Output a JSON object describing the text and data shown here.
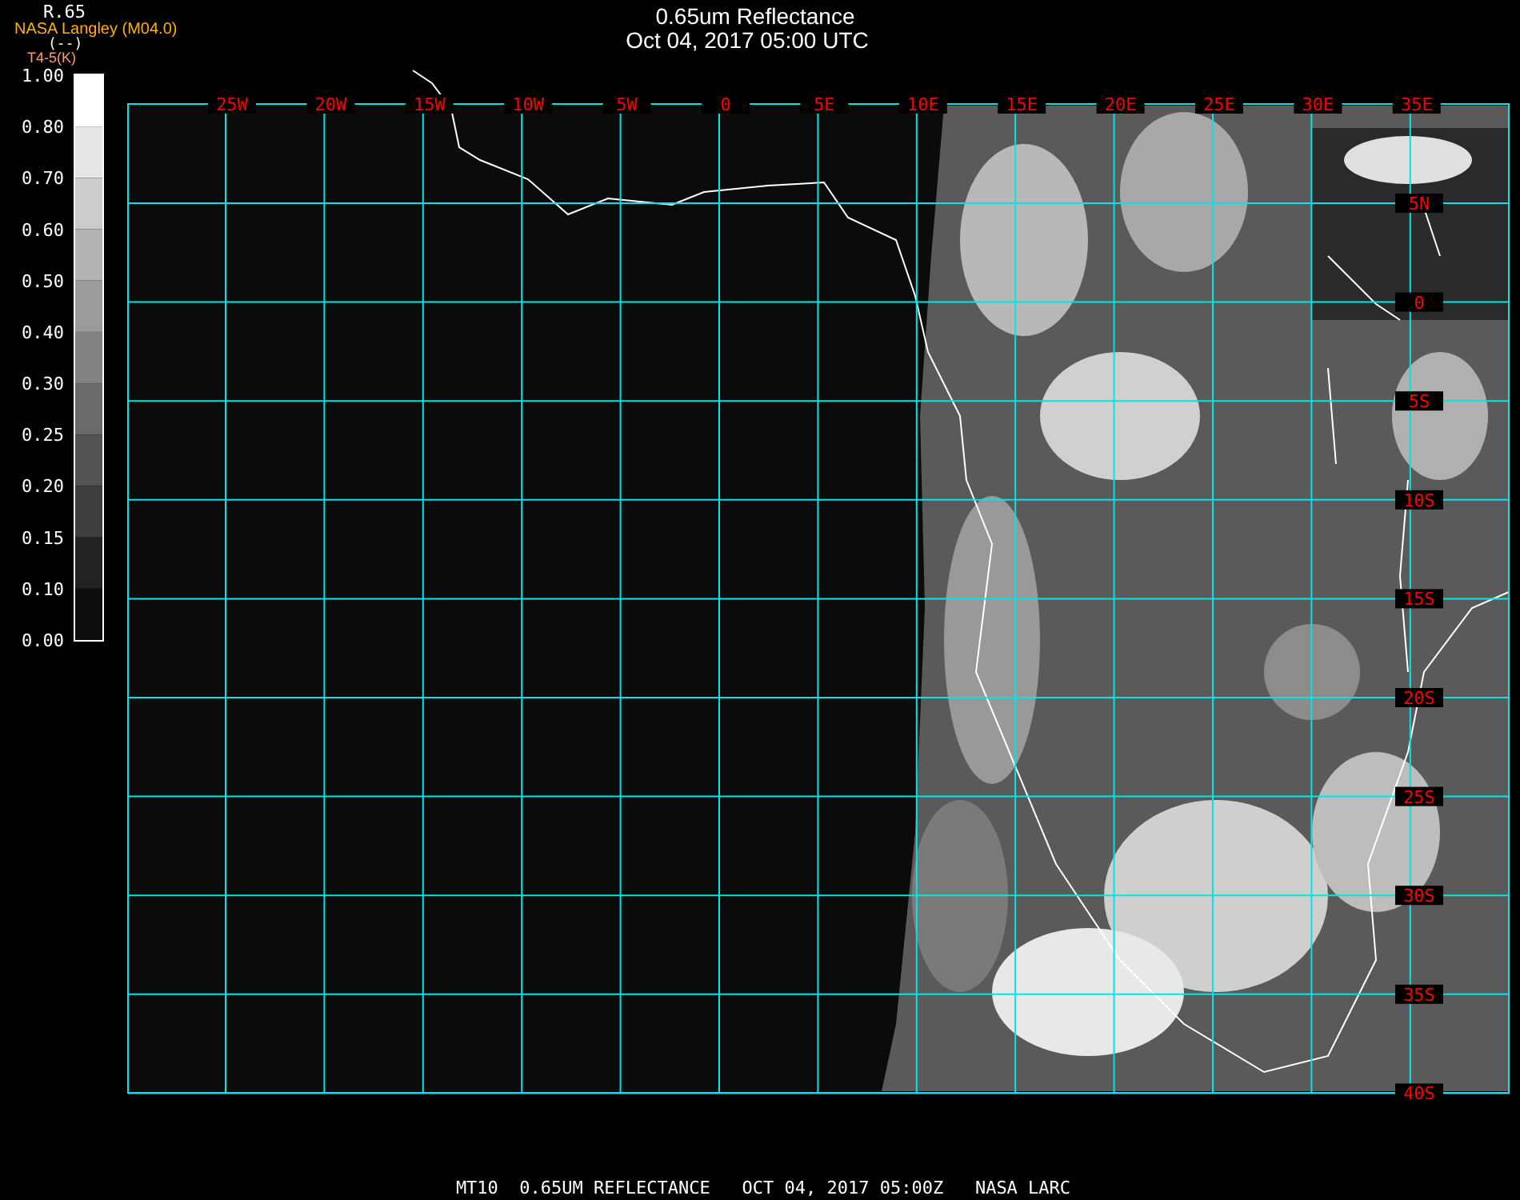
{
  "header": {
    "title": "0.65um Reflectance",
    "timestamp": "Oct 04, 2017 05:00 UTC",
    "source": "NASA Langley (M04.0)"
  },
  "colorbar": {
    "quantity": "R.65",
    "units": "(--)",
    "subtitle": "T4-5(K)",
    "ticks": [
      "1.00",
      "0.80",
      "0.70",
      "0.60",
      "0.50",
      "0.40",
      "0.30",
      "0.25",
      "0.20",
      "0.15",
      "0.10",
      "0.00"
    ],
    "segments": [
      {
        "color": "#ffffff"
      },
      {
        "color": "#e5e5e5"
      },
      {
        "color": "#cccccc"
      },
      {
        "color": "#b3b3b3"
      },
      {
        "color": "#9b9b9b"
      },
      {
        "color": "#828282"
      },
      {
        "color": "#6a6a6a"
      },
      {
        "color": "#545454"
      },
      {
        "color": "#3e3e3e"
      },
      {
        "color": "#222222"
      },
      {
        "color": "#0d0d0d"
      }
    ]
  },
  "map": {
    "longitude_labels": [
      "25W",
      "20W",
      "15W",
      "10W",
      "5W",
      "0",
      "5E",
      "10E",
      "15E",
      "20E",
      "25E",
      "30E",
      "35E"
    ],
    "latitude_labels": [
      "5N",
      "0",
      "5S",
      "10S",
      "15S",
      "20S",
      "25S",
      "30S",
      "35S",
      "40S"
    ]
  },
  "footer": {
    "caption": "MT10  0.65UM REFLECTANCE   OCT 04, 2017 05:00Z   NASA LARC"
  }
}
